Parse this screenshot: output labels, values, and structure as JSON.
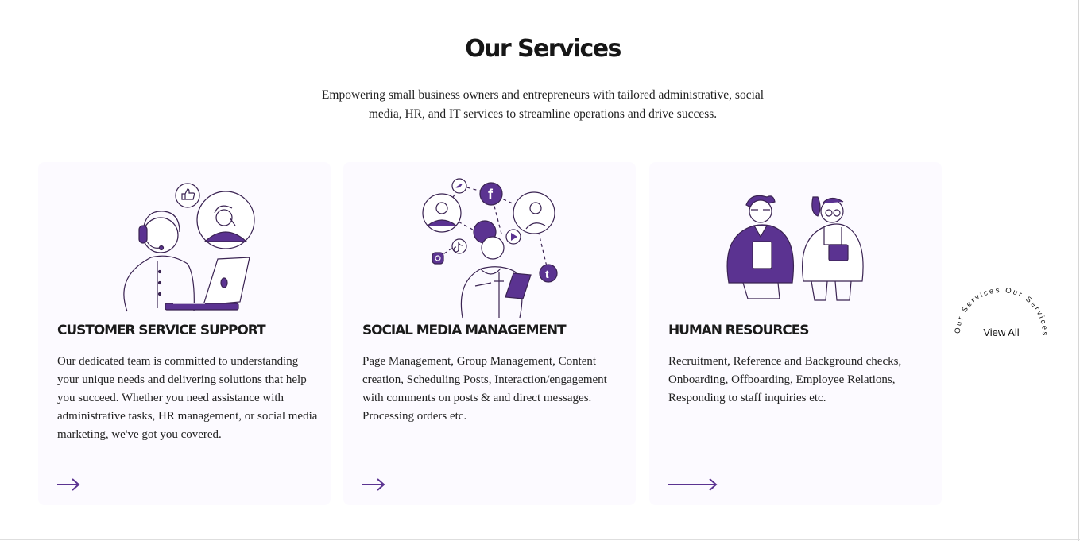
{
  "section": {
    "title": "Our Services",
    "subtitle": "Empowering small business owners and entrepreneurs with tailored administrative, social media, HR, and IT services to streamline operations and drive success."
  },
  "cards": [
    {
      "title": "CUSTOMER SERVICE SUPPORT",
      "description": "Our dedicated team is committed to understanding your unique needs and delivering solutions that help you succeed. Whether you need assistance with administrative tasks, HR management, or social media marketing, we've got you covered.",
      "illustration": "customer-support-illustration",
      "arrow_icon": "arrow-right-icon"
    },
    {
      "title": "SOCIAL MEDIA MANAGEMENT",
      "description": "Page Management, Group Management, Content creation, Scheduling Posts, Interaction/engagement with comments on posts & and direct messages. Processing orders etc.",
      "illustration": "social-media-illustration",
      "arrow_icon": "arrow-right-icon"
    },
    {
      "title": "HUMAN RESOURCES",
      "description": "Recruitment, Reference and Background checks, Onboarding, Offboarding, Employee Relations, Responding to staff inquiries etc.",
      "illustration": "human-resources-illustration",
      "arrow_icon": "arrow-right-long-icon"
    }
  ],
  "view_all": {
    "label": "View All",
    "ring_text": "Our Services Our Services "
  },
  "colors": {
    "accent": "#5b3391",
    "card_background": "#fcfaff",
    "text": "#1f1f1f"
  }
}
